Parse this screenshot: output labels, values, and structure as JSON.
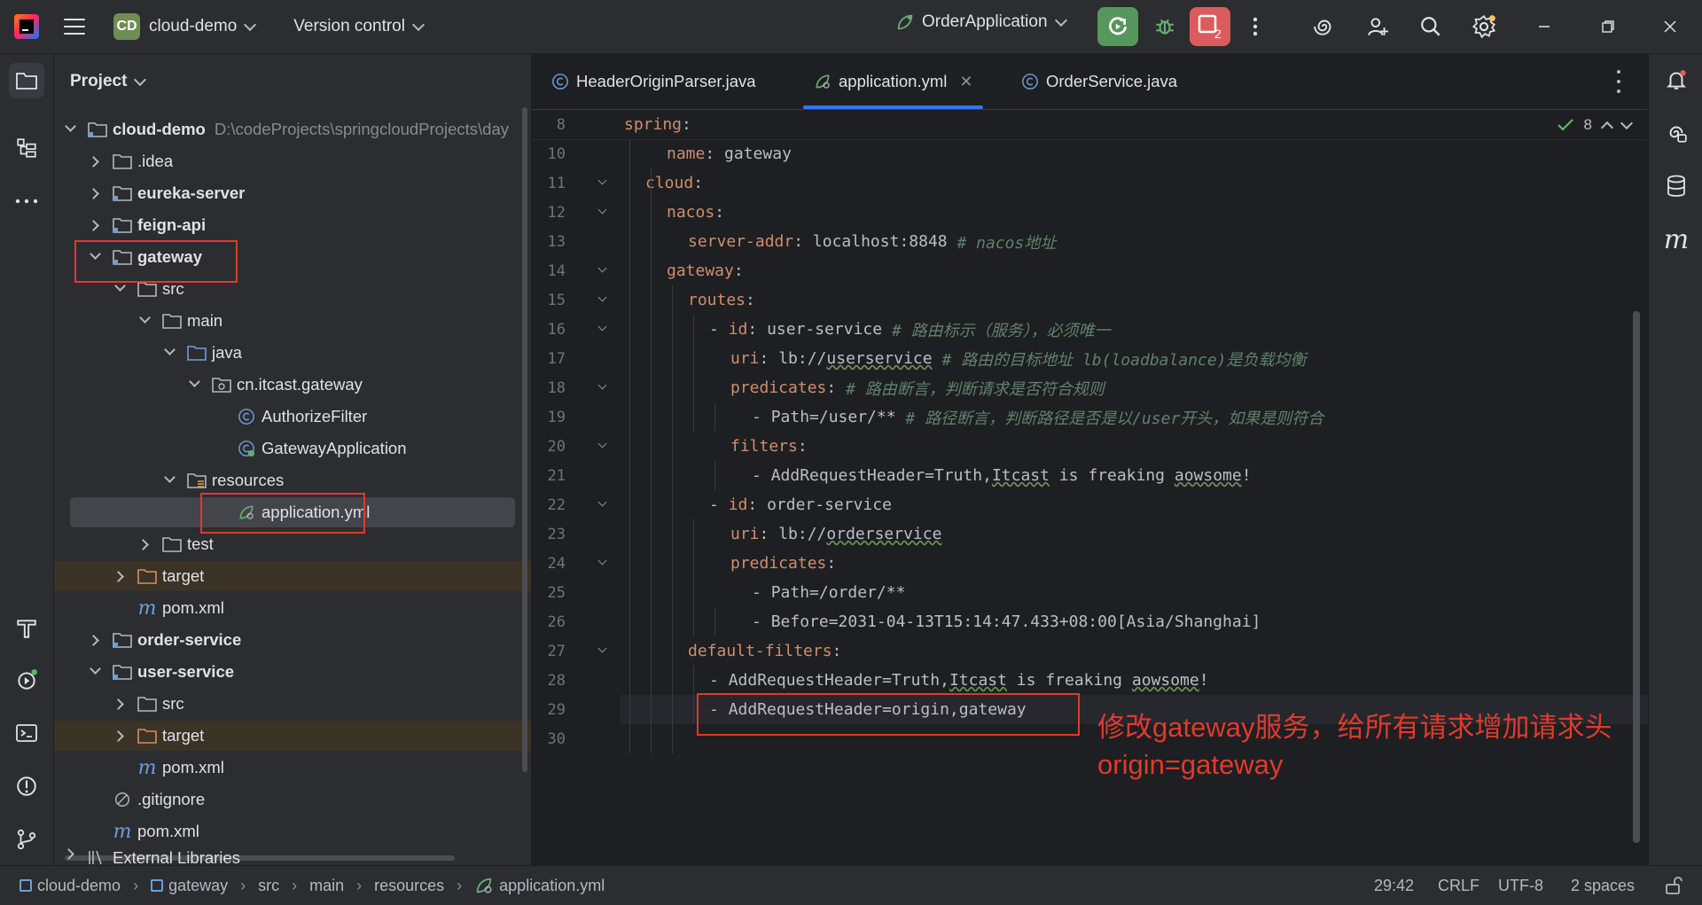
{
  "titlebar": {
    "project_badge": "CD",
    "project_name": "cloud-demo",
    "vcs_label": "Version control",
    "run_config": "OrderApplication",
    "stop_badge": "2"
  },
  "project_panel": {
    "title": "Project",
    "tree": [
      {
        "label": "cloud-demo",
        "path": "D:\\codeProjects\\springcloudProjects\\day"
      },
      {
        "label": ".idea"
      },
      {
        "label": "eureka-server"
      },
      {
        "label": "feign-api"
      },
      {
        "label": "gateway"
      },
      {
        "label": "src"
      },
      {
        "label": "main"
      },
      {
        "label": "java"
      },
      {
        "label": "cn.itcast.gateway"
      },
      {
        "label": "AuthorizeFilter"
      },
      {
        "label": "GatewayApplication"
      },
      {
        "label": "resources"
      },
      {
        "label": "application.yml"
      },
      {
        "label": "test"
      },
      {
        "label": "target"
      },
      {
        "label": "pom.xml"
      },
      {
        "label": "order-service"
      },
      {
        "label": "user-service"
      },
      {
        "label": "src"
      },
      {
        "label": "target"
      },
      {
        "label": "pom.xml"
      },
      {
        "label": ".gitignore"
      },
      {
        "label": "pom.xml"
      },
      {
        "label": "External Libraries"
      }
    ]
  },
  "editor": {
    "tabs": [
      {
        "label": "HeaderOriginParser.java"
      },
      {
        "label": "application.yml"
      },
      {
        "label": "OrderService.java"
      }
    ],
    "inspection_count": "8",
    "sticky": {
      "line": "8",
      "key": "spring"
    },
    "lines": [
      {
        "n": "10",
        "key": "name",
        "val": "gateway",
        "comment": ""
      },
      {
        "n": "11",
        "key": "cloud",
        "val": "",
        "comment": ""
      },
      {
        "n": "12",
        "key": "nacos",
        "val": "",
        "comment": ""
      },
      {
        "n": "13",
        "key": "server-addr",
        "val": "localhost:8848",
        "comment": "# nacos地址"
      },
      {
        "n": "14",
        "key": "gateway",
        "val": "",
        "comment": ""
      },
      {
        "n": "15",
        "key": "routes",
        "val": "",
        "comment": ""
      },
      {
        "n": "16",
        "key": "id",
        "val": "user-service",
        "comment": "# 路由标示（服务），必须唯一"
      },
      {
        "n": "17",
        "key": "uri",
        "val": "lb://userservice",
        "comment": "# 路由的目标地址 lb(loadbalance)是负载均衡"
      },
      {
        "n": "18",
        "key": "predicates",
        "val": "",
        "comment": "# 路由断言，判断请求是否符合规则"
      },
      {
        "n": "19",
        "key": "",
        "val": "Path=/user/**",
        "comment": "# 路径断言，判断路径是否是以/user开头，如果是则符合"
      },
      {
        "n": "20",
        "key": "filters",
        "val": "",
        "comment": ""
      },
      {
        "n": "21",
        "key": "",
        "val": "AddRequestHeader=Truth,Itcast is freaking aowsome!",
        "comment": ""
      },
      {
        "n": "22",
        "key": "id",
        "val": "order-service",
        "comment": ""
      },
      {
        "n": "23",
        "key": "uri",
        "val": "lb://orderservice",
        "comment": ""
      },
      {
        "n": "24",
        "key": "predicates",
        "val": "",
        "comment": ""
      },
      {
        "n": "25",
        "key": "",
        "val": "Path=/order/**",
        "comment": ""
      },
      {
        "n": "26",
        "key": "",
        "val": "Before=2031-04-13T15:14:47.433+08:00[Asia/Shanghai]",
        "comment": ""
      },
      {
        "n": "27",
        "key": "default-filters",
        "val": "",
        "comment": ""
      },
      {
        "n": "28",
        "key": "",
        "val": "AddRequestHeader=Truth,Itcast is freaking aowsome!",
        "comment": ""
      },
      {
        "n": "29",
        "key": "",
        "val": "AddRequestHeader=origin,gateway",
        "comment": ""
      },
      {
        "n": "30",
        "key": "",
        "val": "",
        "comment": ""
      }
    ]
  },
  "annotation": {
    "line1": "修改gateway服务，给所有请求增加请求头",
    "line2": "origin=gateway"
  },
  "statusbar": {
    "breadcrumbs": [
      "cloud-demo",
      "gateway",
      "src",
      "main",
      "resources",
      "application.yml"
    ],
    "position": "29:42",
    "line_sep": "CRLF",
    "encoding": "UTF-8",
    "indent": "2 spaces"
  },
  "colors": {
    "accent": "#3574f0",
    "annotation_red": "#e03a2c",
    "run_green": "#57965c",
    "stop_red": "#db5c5c"
  }
}
